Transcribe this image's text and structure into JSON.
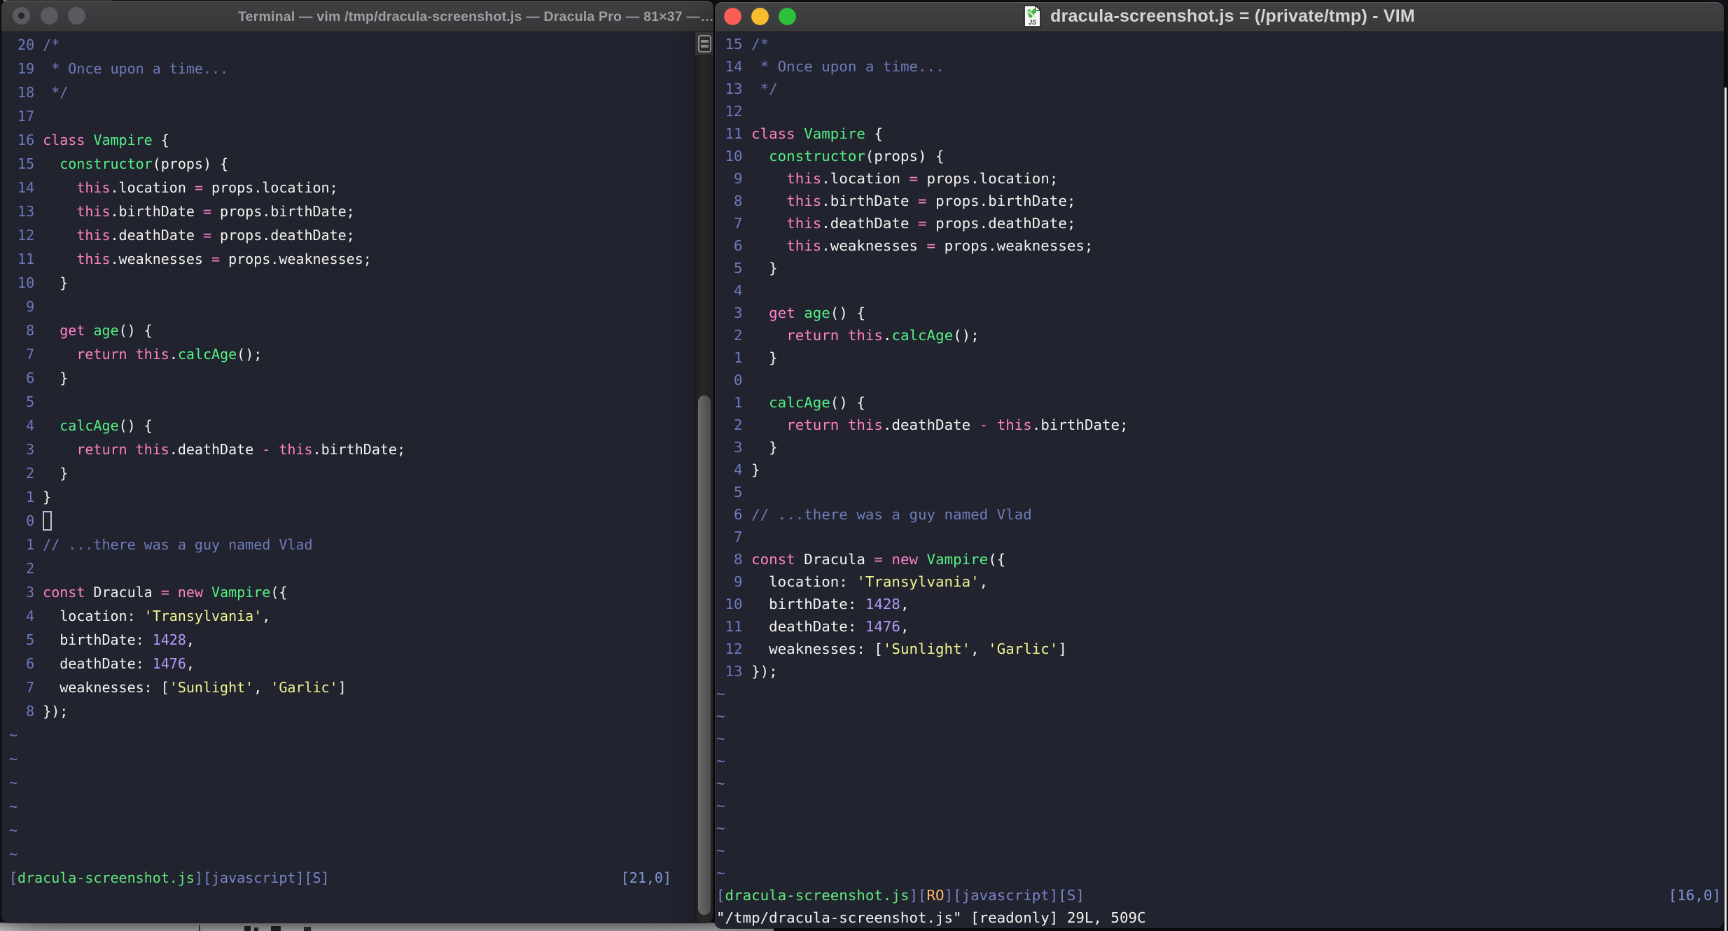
{
  "theme": {
    "editor_background": "#21232f",
    "titlebar_gray": "#3a3a3c",
    "foreground": "#f3f3ef",
    "comment_blue": "#6e7ab8",
    "keyword_pink": "#ff82c6",
    "function_green": "#55f083",
    "string_yellow": "#f1f590",
    "number_purple": "#b29af7",
    "status_orange": "#ffb86c",
    "traffic_red": "#f95f57",
    "traffic_yellow": "#f8bd2f",
    "traffic_green": "#2cc03b"
  },
  "left_window": {
    "app": "Terminal",
    "title": "Terminal — vim /tmp/dracula-screenshot.js — Dracula Pro — 81×37 —…",
    "traffic_lights": [
      "close",
      "minimize",
      "zoom"
    ],
    "cursor_line": 21,
    "cursor_col": 0,
    "tilde_rows": 6,
    "statusline": [
      [
        "sb",
        "["
      ],
      [
        "sg",
        "dracula-screenshot.js"
      ],
      [
        "sb",
        "][javascript][S]"
      ]
    ],
    "ruler": "[21,0]",
    "cmdline": ""
  },
  "right_window": {
    "app": "VIM",
    "title": "dracula-screenshot.js = (/private/tmp) - VIM",
    "doc_icon_label": "JS",
    "traffic_lights": [
      "close",
      "minimize",
      "zoom"
    ],
    "cursor_line": 16,
    "cursor_col": 0,
    "tilde_rows": 9,
    "statusline": [
      [
        "sb",
        "["
      ],
      [
        "sg",
        "dracula-screenshot.js"
      ],
      [
        "sb",
        "]["
      ],
      [
        "so",
        "RO"
      ],
      [
        "sb",
        "][javascript][S]"
      ]
    ],
    "ruler": "[16,0]",
    "cmdline": "\"/tmp/dracula-screenshot.js\" [readonly] 29L, 509C"
  },
  "buffer": {
    "file": "dracula-screenshot.js",
    "lines": [
      [
        [
          "com",
          "/*"
        ]
      ],
      [
        [
          "com",
          " * Once upon a time..."
        ]
      ],
      [
        [
          "com",
          " */"
        ]
      ],
      [],
      [
        [
          "pink",
          "class"
        ],
        [
          "fg",
          " "
        ],
        [
          "green",
          "Vampire"
        ],
        [
          "fg",
          " {"
        ]
      ],
      [
        [
          "fg",
          "  "
        ],
        [
          "green",
          "constructor"
        ],
        [
          "fg",
          "(props) {"
        ]
      ],
      [
        [
          "fg",
          "    "
        ],
        [
          "pink",
          "this"
        ],
        [
          "fg",
          ".location "
        ],
        [
          "pink",
          "="
        ],
        [
          "fg",
          " props.location;"
        ]
      ],
      [
        [
          "fg",
          "    "
        ],
        [
          "pink",
          "this"
        ],
        [
          "fg",
          ".birthDate "
        ],
        [
          "pink",
          "="
        ],
        [
          "fg",
          " props.birthDate;"
        ]
      ],
      [
        [
          "fg",
          "    "
        ],
        [
          "pink",
          "this"
        ],
        [
          "fg",
          ".deathDate "
        ],
        [
          "pink",
          "="
        ],
        [
          "fg",
          " props.deathDate;"
        ]
      ],
      [
        [
          "fg",
          "    "
        ],
        [
          "pink",
          "this"
        ],
        [
          "fg",
          ".weaknesses "
        ],
        [
          "pink",
          "="
        ],
        [
          "fg",
          " props.weaknesses;"
        ]
      ],
      [
        [
          "fg",
          "  }"
        ]
      ],
      [],
      [
        [
          "fg",
          "  "
        ],
        [
          "pink",
          "get"
        ],
        [
          "fg",
          " "
        ],
        [
          "green",
          "age"
        ],
        [
          "fg",
          "() {"
        ]
      ],
      [
        [
          "fg",
          "    "
        ],
        [
          "pink",
          "return"
        ],
        [
          "fg",
          " "
        ],
        [
          "pink",
          "this"
        ],
        [
          "fg",
          "."
        ],
        [
          "green",
          "calcAge"
        ],
        [
          "fg",
          "();"
        ]
      ],
      [
        [
          "fg",
          "  }"
        ]
      ],
      [],
      [
        [
          "fg",
          "  "
        ],
        [
          "green",
          "calcAge"
        ],
        [
          "fg",
          "() {"
        ]
      ],
      [
        [
          "fg",
          "    "
        ],
        [
          "pink",
          "return"
        ],
        [
          "fg",
          " "
        ],
        [
          "pink",
          "this"
        ],
        [
          "fg",
          ".deathDate "
        ],
        [
          "pink",
          "-"
        ],
        [
          "fg",
          " "
        ],
        [
          "pink",
          "this"
        ],
        [
          "fg",
          ".birthDate;"
        ]
      ],
      [
        [
          "fg",
          "  }"
        ]
      ],
      [
        [
          "fg",
          "}"
        ]
      ],
      [],
      [
        [
          "com",
          "// ...there was a guy named Vlad"
        ]
      ],
      [],
      [
        [
          "pink",
          "const"
        ],
        [
          "fg",
          " Dracula "
        ],
        [
          "pink",
          "="
        ],
        [
          "fg",
          " "
        ],
        [
          "pink",
          "new"
        ],
        [
          "fg",
          " "
        ],
        [
          "green",
          "Vampire"
        ],
        [
          "fg",
          "({"
        ]
      ],
      [
        [
          "fg",
          "  location: "
        ],
        [
          "yellow",
          "'Transylvania'"
        ],
        [
          "fg",
          ","
        ]
      ],
      [
        [
          "fg",
          "  birthDate: "
        ],
        [
          "purple",
          "1428"
        ],
        [
          "fg",
          ","
        ]
      ],
      [
        [
          "fg",
          "  deathDate: "
        ],
        [
          "purple",
          "1476"
        ],
        [
          "fg",
          ","
        ]
      ],
      [
        [
          "fg",
          "  weaknesses: ["
        ],
        [
          "yellow",
          "'Sunlight'"
        ],
        [
          "fg",
          ", "
        ],
        [
          "yellow",
          "'Garlic'"
        ],
        [
          "fg",
          "]"
        ]
      ],
      [
        [
          "fg",
          "});"
        ]
      ]
    ]
  }
}
